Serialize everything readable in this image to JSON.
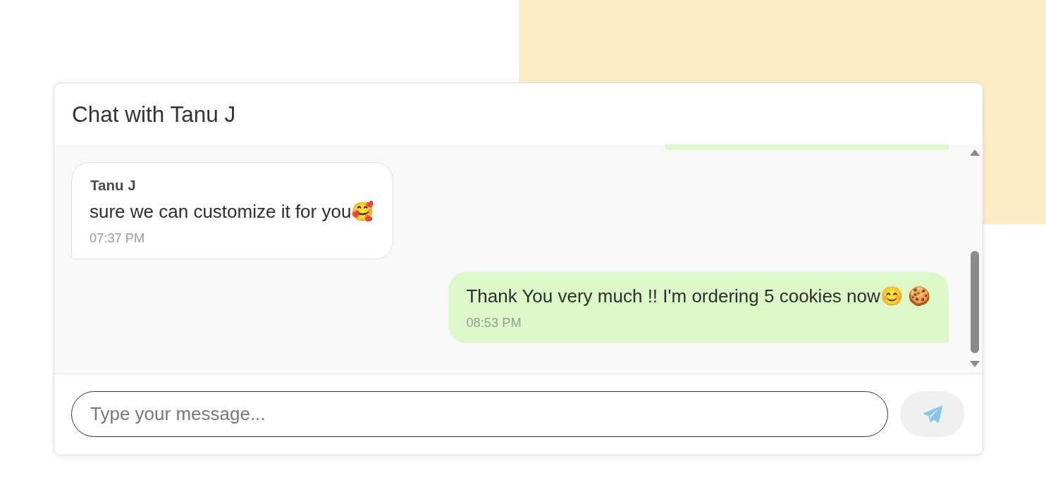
{
  "chat": {
    "title": "Chat with Tanu J"
  },
  "messages": [
    {
      "kind": "cut-off",
      "outgoing": true
    },
    {
      "kind": "text",
      "outgoing": false,
      "sender": "Tanu J",
      "text": "sure we can customize it for you🥰",
      "time": "07:37 PM"
    },
    {
      "kind": "text",
      "outgoing": true,
      "text": "Thank You very much !! I'm ordering 5 cookies now😊 🍪",
      "time": "08:53 PM"
    }
  ],
  "composer": {
    "placeholder": "Type your message..."
  }
}
